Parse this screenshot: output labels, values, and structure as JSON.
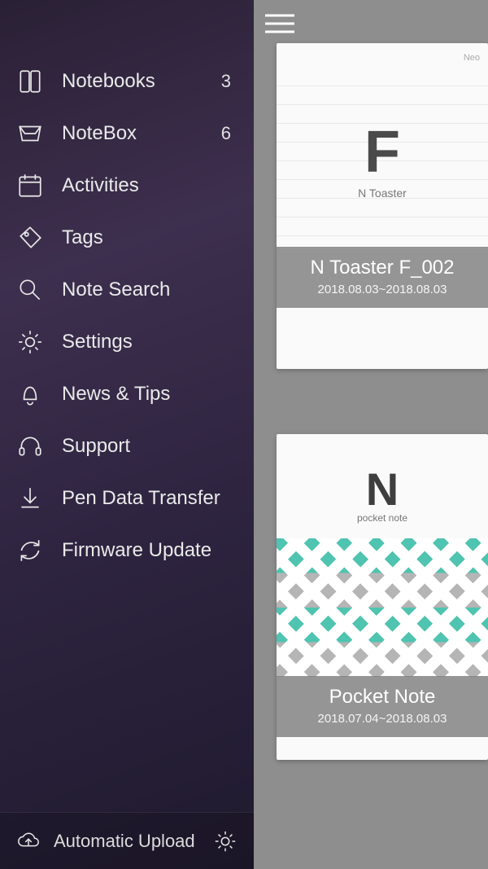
{
  "sidebar": {
    "items": [
      {
        "label": "Notebooks",
        "badge": "3"
      },
      {
        "label": "NoteBox",
        "badge": "6"
      },
      {
        "label": "Activities"
      },
      {
        "label": "Tags"
      },
      {
        "label": "Note Search"
      },
      {
        "label": "Settings"
      },
      {
        "label": "News & Tips"
      },
      {
        "label": "Support"
      },
      {
        "label": "Pen Data Transfer"
      },
      {
        "label": "Firmware Update"
      }
    ],
    "bottom": {
      "label": "Automatic Upload"
    }
  },
  "cards": [
    {
      "letter": "F",
      "coverLabel": "N Toaster",
      "brand": "Neo",
      "title": "N Toaster F_002",
      "date": "2018.08.03~2018.08.03"
    },
    {
      "letter": "N",
      "coverLabel": "pocket note",
      "title": "Pocket Note",
      "date": "2018.07.04~2018.08.03"
    }
  ]
}
